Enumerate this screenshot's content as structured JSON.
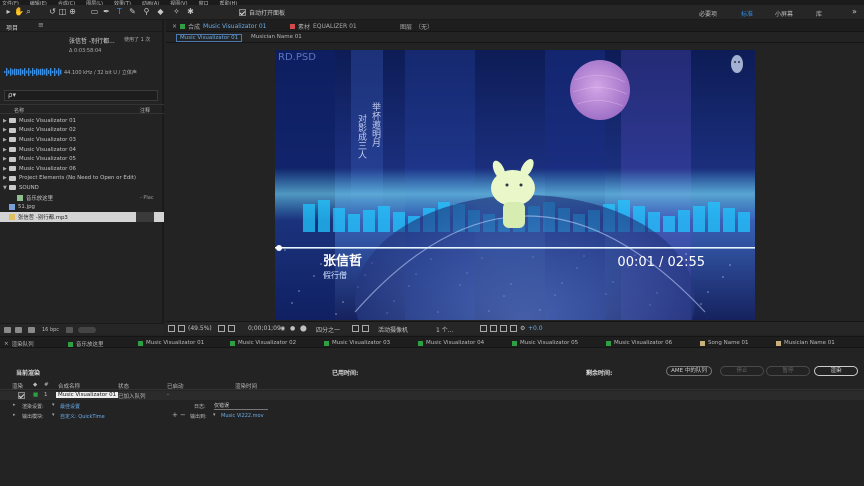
{
  "menu": [
    "文件(F)",
    "编辑(E)",
    "合成(C)",
    "图层(L)",
    "效果(T)",
    "动画(A)",
    "视图(V)",
    "窗口",
    "帮助(H)"
  ],
  "toolbar": {
    "auto_open": "自动打开面板",
    "workspaces": [
      "必要项",
      "标准",
      "小屏幕",
      "库"
    ],
    "active_workspace": "标准"
  },
  "project": {
    "title": "项目",
    "asset_name": "张信哲 -别行都...",
    "used": "使用了 1 次",
    "duration": "Δ 0:03:58:04",
    "audio_info": "44.100 kHz / 32 bit U / 立体声",
    "search_glyph": "ρ▾",
    "col_name": "名称",
    "col_note": "注释",
    "items": [
      {
        "type": "folder",
        "label": "Music Visualizator 01",
        "depth": 0,
        "selected": false,
        "extra": ""
      },
      {
        "type": "folder",
        "label": "Music Visualizator 02",
        "depth": 0,
        "selected": false,
        "extra": ""
      },
      {
        "type": "folder",
        "label": "Music Visualizator 03",
        "depth": 0,
        "selected": false,
        "extra": ""
      },
      {
        "type": "folder",
        "label": "Music Visualizator 04",
        "depth": 0,
        "selected": false,
        "extra": ""
      },
      {
        "type": "folder",
        "label": "Music Visualizator 05",
        "depth": 0,
        "selected": false,
        "extra": ""
      },
      {
        "type": "folder",
        "label": "Music Visualizator 06",
        "depth": 0,
        "selected": false,
        "extra": ""
      },
      {
        "type": "folder",
        "label": "Project Elements (No Need to Open or Edit)",
        "depth": 0,
        "selected": false,
        "extra": ""
      },
      {
        "type": "folder-open",
        "label": "SOUND",
        "depth": 0,
        "selected": false,
        "extra": ""
      },
      {
        "type": "comp",
        "label": "音乐放这里",
        "depth": 1,
        "selected": false,
        "extra": "- Plac"
      },
      {
        "type": "image",
        "label": "51.jpg",
        "depth": 0,
        "selected": false,
        "extra": ""
      },
      {
        "type": "audio",
        "label": "张信哲 -别行都.mp3",
        "depth": 0,
        "selected": true,
        "extra": ""
      }
    ],
    "bpc": "16 bpc"
  },
  "comp": {
    "tabs": [
      {
        "prefix": "合成",
        "name": "Music Visualizator 01",
        "color": "#2ea043",
        "active": true
      },
      {
        "prefix": "素材",
        "name": "EQUALIZER 01",
        "color": "#d24a4a",
        "active": false
      },
      {
        "prefix": "图层",
        "name": "（无）",
        "color": "",
        "active": false
      }
    ],
    "subtabs": [
      "Music Visualizator 01",
      "Musician Name 01"
    ],
    "viewer": {
      "artist": "张信哲",
      "song": "假行僧",
      "time": "00:01 / 02:55",
      "corner_label": "RD.PSD",
      "poem_lines": [
        "举杯邀明月",
        "对影成三人"
      ]
    },
    "footer": {
      "zoom": "(49.5%)",
      "timecode": "0;00;01;09",
      "resolution": "四分之一",
      "camera": "活动摄像机",
      "views": "1 个...",
      "exposure": "+0.0"
    }
  },
  "render": {
    "tabs": [
      {
        "label": "渲染队列",
        "color": "",
        "active": true
      },
      {
        "label": "音乐放这里",
        "color": "#2ea043"
      },
      {
        "label": "Music Visualizator 01",
        "color": "#2ea043"
      },
      {
        "label": "Music Visualizator 02",
        "color": "#2ea043"
      },
      {
        "label": "Music Visualizator 03",
        "color": "#2ea043"
      },
      {
        "label": "Music Visualizator 04",
        "color": "#2ea043"
      },
      {
        "label": "Music Visualizator 05",
        "color": "#2ea043"
      },
      {
        "label": "Music Visualizator 06",
        "color": "#2ea043"
      },
      {
        "label": "Song Name 01",
        "color": "#c9b07a"
      },
      {
        "label": "Musician Name 01",
        "color": "#c9b07a"
      }
    ],
    "current": "当前渲染",
    "elapsed": "已用时间:",
    "remaining": "剩余时间:",
    "btn_ame": "AME 中的队列",
    "btn_stop": "停止",
    "btn_pause": "暂停",
    "btn_render": "渲染",
    "cols": [
      "渲染",
      "#",
      "合成名称",
      "状态",
      "已启动",
      "渲染时间"
    ],
    "item": {
      "index": "1",
      "name": "Music Visualizator 01",
      "status": "已加入队列",
      "started": "-",
      "render_settings_label": "渲染设置:",
      "render_settings_value": "最佳设置",
      "log_label": "日志:",
      "log_value": "仅错误",
      "output_module_label": "输出模块:",
      "output_module_value": "自定义: QuickTime",
      "output_to_label": "输出到:",
      "output_to_value": "Music Vi222.mov"
    }
  }
}
